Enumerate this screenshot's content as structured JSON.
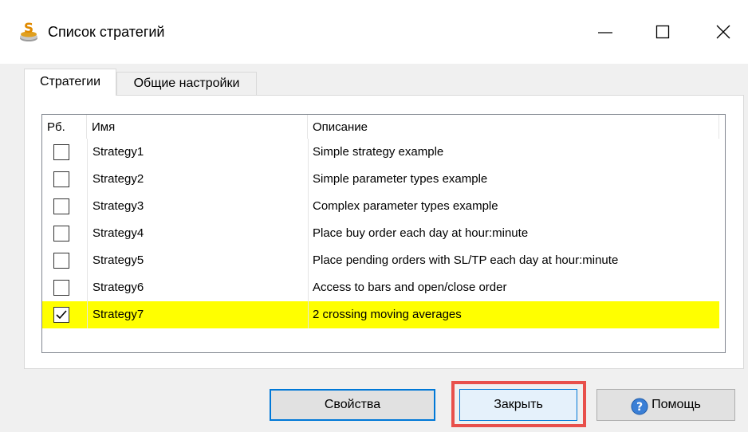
{
  "window": {
    "title": "Список стратегий",
    "icons": {
      "app": "coins-money-icon",
      "minimize": "minimize-icon",
      "maximize": "maximize-icon",
      "close": "close-icon"
    }
  },
  "tabs": [
    {
      "label": "Стратегии",
      "active": true
    },
    {
      "label": "Общие настройки",
      "active": false
    }
  ],
  "table": {
    "columns": [
      "Рб.",
      "Имя",
      "Описание"
    ],
    "rows": [
      {
        "checked": false,
        "name": "Strategy1",
        "description": "Simple strategy example"
      },
      {
        "checked": false,
        "name": "Strategy2",
        "description": "Simple parameter types example"
      },
      {
        "checked": false,
        "name": "Strategy3",
        "description": "Complex parameter types example"
      },
      {
        "checked": false,
        "name": "Strategy4",
        "description": "Place buy order each day at hour:minute"
      },
      {
        "checked": false,
        "name": "Strategy5",
        "description": "Place pending orders with SL/TP each day at hour:minute"
      },
      {
        "checked": false,
        "name": "Strategy6",
        "description": "Access to bars and open/close order"
      },
      {
        "checked": true,
        "name": "Strategy7",
        "description": "2 crossing moving averages",
        "selected": true
      }
    ]
  },
  "buttons": {
    "properties": "Свойства",
    "close": "Закрыть",
    "help": "Помощь"
  },
  "colors": {
    "selected_row": "#ffff00",
    "highlight_box": "#e8504b",
    "accent": "#0078d7"
  }
}
